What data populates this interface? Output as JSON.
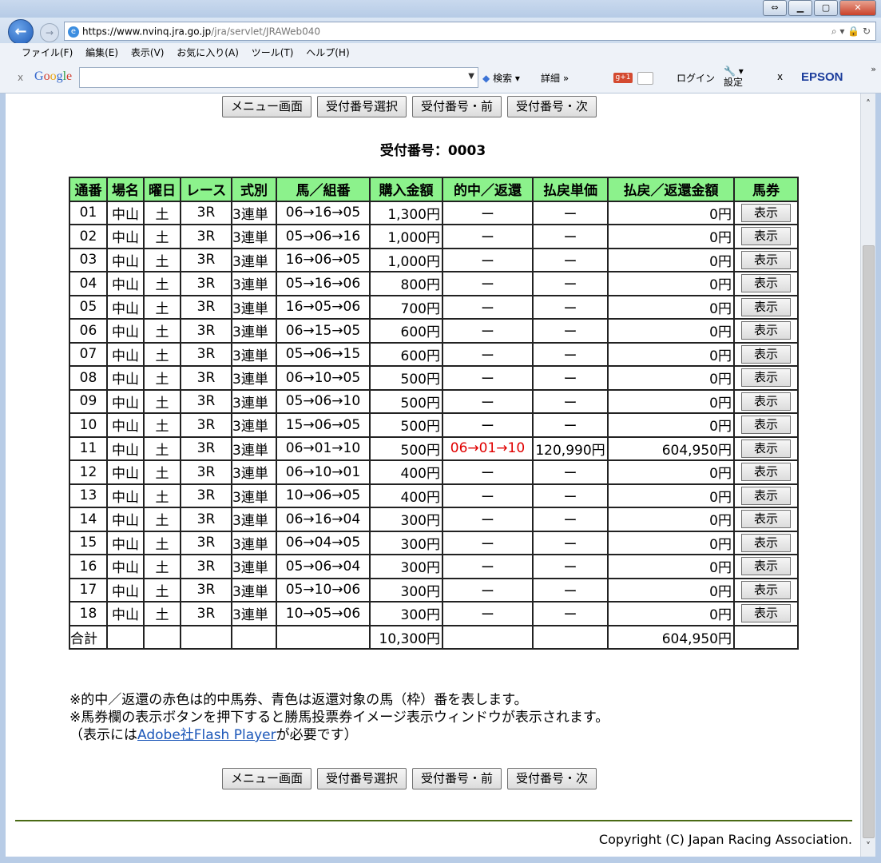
{
  "browser": {
    "url_host": "https://www.nvinq.jra.go.jp",
    "url_path": "/jra/servlet/JRAWeb040",
    "address_tools": "⌕ ▾ 🔒 ↻",
    "menu": [
      "ファイル(F)",
      "編集(E)",
      "表示(V)",
      "お気に入り(A)",
      "ツール(T)",
      "ヘルプ(H)"
    ],
    "google_bar": {
      "close": "x",
      "search_label": "検索",
      "detail_label": "詳細",
      "login_label": "ログイン",
      "settings_label": "設定",
      "brand": "EPSON"
    }
  },
  "nav_buttons": {
    "menu": "メニュー画面",
    "select": "受付番号選択",
    "prev": "受付番号・前",
    "next": "受付番号・次"
  },
  "receipt_title": "受付番号：0003",
  "table": {
    "headers": [
      "通番",
      "場名",
      "曜日",
      "レース",
      "式別",
      "馬／組番",
      "購入金額",
      "的中／返還",
      "払戻単価",
      "払戻／返還金額",
      "馬券"
    ],
    "show_label": "表示",
    "rows": [
      {
        "no": "01",
        "place": "中山",
        "day": "土",
        "race": "3R",
        "type": "3連単",
        "combo": "06→16→05",
        "amount": "1,300円",
        "hit": "ー",
        "unit": "ー",
        "payout": "0円"
      },
      {
        "no": "02",
        "place": "中山",
        "day": "土",
        "race": "3R",
        "type": "3連単",
        "combo": "05→06→16",
        "amount": "1,000円",
        "hit": "ー",
        "unit": "ー",
        "payout": "0円"
      },
      {
        "no": "03",
        "place": "中山",
        "day": "土",
        "race": "3R",
        "type": "3連単",
        "combo": "16→06→05",
        "amount": "1,000円",
        "hit": "ー",
        "unit": "ー",
        "payout": "0円"
      },
      {
        "no": "04",
        "place": "中山",
        "day": "土",
        "race": "3R",
        "type": "3連単",
        "combo": "05→16→06",
        "amount": "800円",
        "hit": "ー",
        "unit": "ー",
        "payout": "0円"
      },
      {
        "no": "05",
        "place": "中山",
        "day": "土",
        "race": "3R",
        "type": "3連単",
        "combo": "16→05→06",
        "amount": "700円",
        "hit": "ー",
        "unit": "ー",
        "payout": "0円"
      },
      {
        "no": "06",
        "place": "中山",
        "day": "土",
        "race": "3R",
        "type": "3連単",
        "combo": "06→15→05",
        "amount": "600円",
        "hit": "ー",
        "unit": "ー",
        "payout": "0円"
      },
      {
        "no": "07",
        "place": "中山",
        "day": "土",
        "race": "3R",
        "type": "3連単",
        "combo": "05→06→15",
        "amount": "600円",
        "hit": "ー",
        "unit": "ー",
        "payout": "0円"
      },
      {
        "no": "08",
        "place": "中山",
        "day": "土",
        "race": "3R",
        "type": "3連単",
        "combo": "06→10→05",
        "amount": "500円",
        "hit": "ー",
        "unit": "ー",
        "payout": "0円"
      },
      {
        "no": "09",
        "place": "中山",
        "day": "土",
        "race": "3R",
        "type": "3連単",
        "combo": "05→06→10",
        "amount": "500円",
        "hit": "ー",
        "unit": "ー",
        "payout": "0円"
      },
      {
        "no": "10",
        "place": "中山",
        "day": "土",
        "race": "3R",
        "type": "3連単",
        "combo": "15→06→05",
        "amount": "500円",
        "hit": "ー",
        "unit": "ー",
        "payout": "0円"
      },
      {
        "no": "11",
        "place": "中山",
        "day": "土",
        "race": "3R",
        "type": "3連単",
        "combo": "06→01→10",
        "amount": "500円",
        "hit": "06→01→10",
        "unit": "120,990円",
        "payout": "604,950円",
        "winner": true
      },
      {
        "no": "12",
        "place": "中山",
        "day": "土",
        "race": "3R",
        "type": "3連単",
        "combo": "06→10→01",
        "amount": "400円",
        "hit": "ー",
        "unit": "ー",
        "payout": "0円"
      },
      {
        "no": "13",
        "place": "中山",
        "day": "土",
        "race": "3R",
        "type": "3連単",
        "combo": "10→06→05",
        "amount": "400円",
        "hit": "ー",
        "unit": "ー",
        "payout": "0円"
      },
      {
        "no": "14",
        "place": "中山",
        "day": "土",
        "race": "3R",
        "type": "3連単",
        "combo": "06→16→04",
        "amount": "300円",
        "hit": "ー",
        "unit": "ー",
        "payout": "0円"
      },
      {
        "no": "15",
        "place": "中山",
        "day": "土",
        "race": "3R",
        "type": "3連単",
        "combo": "06→04→05",
        "amount": "300円",
        "hit": "ー",
        "unit": "ー",
        "payout": "0円"
      },
      {
        "no": "16",
        "place": "中山",
        "day": "土",
        "race": "3R",
        "type": "3連単",
        "combo": "05→06→04",
        "amount": "300円",
        "hit": "ー",
        "unit": "ー",
        "payout": "0円"
      },
      {
        "no": "17",
        "place": "中山",
        "day": "土",
        "race": "3R",
        "type": "3連単",
        "combo": "05→10→06",
        "amount": "300円",
        "hit": "ー",
        "unit": "ー",
        "payout": "0円"
      },
      {
        "no": "18",
        "place": "中山",
        "day": "土",
        "race": "3R",
        "type": "3連単",
        "combo": "10→05→06",
        "amount": "300円",
        "hit": "ー",
        "unit": "ー",
        "payout": "0円"
      }
    ],
    "total": {
      "label": "合計",
      "amount": "10,300円",
      "payout": "604,950円"
    }
  },
  "notes": {
    "line1": "※的中／返還の赤色は的中馬券、青色は返還対象の馬（枠）番を表します。",
    "line2": "※馬券欄の表示ボタンを押下すると勝馬投票券イメージ表示ウィンドウが表示されます。",
    "line3_prefix": "（表示には",
    "line3_link": "Adobe社Flash Player",
    "line3_suffix": "が必要です）"
  },
  "copyright": "Copyright (C) Japan Racing Association.",
  "colors": {
    "header_bg": "#8cf28c",
    "hit_red": "#e00000",
    "link_blue": "#1a56b8"
  }
}
